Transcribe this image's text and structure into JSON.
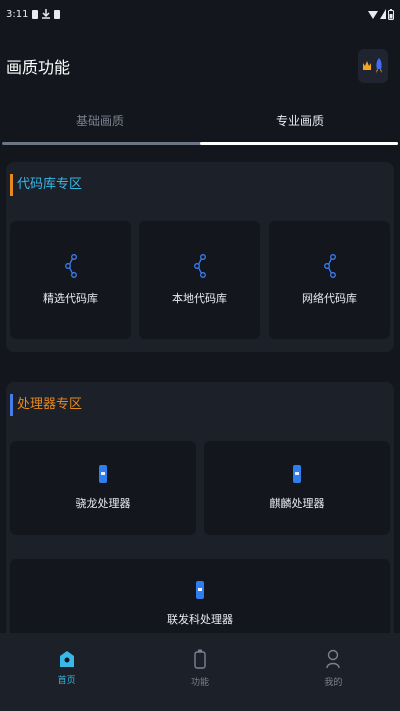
{
  "status_bar": {
    "time": "3:11"
  },
  "header": {
    "title": "画质功能"
  },
  "tabs": [
    {
      "label": "基础画质",
      "active": false
    },
    {
      "label": "专业画质",
      "active": true
    }
  ],
  "sections": {
    "code": {
      "title": "代码库专区",
      "cards": [
        {
          "label": "精选代码库",
          "icon": "share-nodes-icon"
        },
        {
          "label": "本地代码库",
          "icon": "share-nodes-icon"
        },
        {
          "label": "网络代码库",
          "icon": "share-nodes-icon"
        }
      ]
    },
    "processor": {
      "title": "处理器专区",
      "cards": [
        {
          "label": "骁龙处理器",
          "icon": "chip-icon"
        },
        {
          "label": "麒麟处理器",
          "icon": "chip-icon"
        },
        {
          "label": "联发科处理器",
          "icon": "chip-icon"
        }
      ]
    }
  },
  "bottom_nav": [
    {
      "label": "首页",
      "icon": "home-icon",
      "active": true
    },
    {
      "label": "功能",
      "icon": "battery-icon",
      "active": false
    },
    {
      "label": "我的",
      "icon": "user-icon",
      "active": false
    }
  ],
  "colors": {
    "background": "#13161d",
    "surface": "#1c2029",
    "accent_cyan": "#39b8e8",
    "accent_orange": "#e68a1f",
    "accent_blue": "#2f7ef0"
  }
}
